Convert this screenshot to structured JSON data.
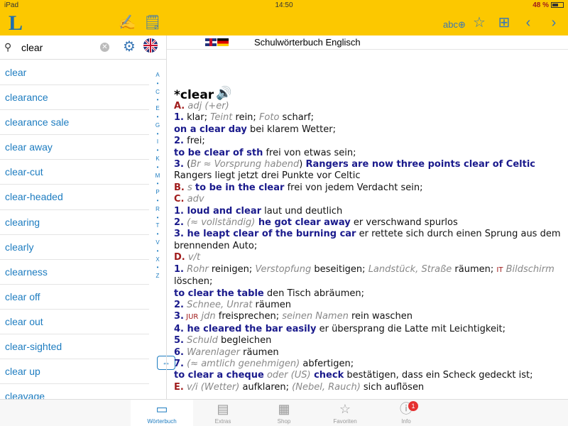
{
  "status": {
    "device": "iPad",
    "time": "14:50",
    "battery": "48 %",
    "battery_level": 0.48
  },
  "toolbar": {
    "logo": "L",
    "icons": [
      "handwriting-icon",
      "vocabulary-card-icon",
      "add-word-icon",
      "star-add-icon",
      "folder-add-icon",
      "back-arrow-icon",
      "forward-arrow-icon"
    ],
    "accent": "#fcc800",
    "icon_color": "#3a78b6"
  },
  "search": {
    "value": "clear",
    "placeholder": ""
  },
  "wordlist": {
    "items": [
      "clear",
      "clearance",
      "clearance sale",
      "clear away",
      "clear-cut",
      "clear-headed",
      "clearing",
      "clearly",
      "clearness",
      "clear off",
      "clear out",
      "clear-sighted",
      "clear up",
      "cleavage"
    ],
    "link_color": "#1d7cc0"
  },
  "alphabet": [
    "A",
    "•",
    "C",
    "•",
    "E",
    "•",
    "G",
    "•",
    "I",
    "•",
    "K",
    "•",
    "M",
    "•",
    "P",
    "•",
    "R",
    "•",
    "T",
    "•",
    "V",
    "•",
    "X",
    "•",
    "Z"
  ],
  "dictionary": {
    "title": "Schulwörterbuch Englisch"
  },
  "entry": {
    "headword": "*clear",
    "lines": [
      [
        {
          "c": "r",
          "t": "A."
        },
        {
          "c": "it",
          "t": " adj (+er)"
        }
      ],
      [
        {
          "c": "b",
          "t": "1."
        },
        {
          "c": "",
          "t": " klar; "
        },
        {
          "c": "it",
          "t": "Teint"
        },
        {
          "c": "",
          "t": " rein; "
        },
        {
          "c": "it",
          "t": "Foto"
        },
        {
          "c": "",
          "t": " scharf;"
        }
      ],
      [
        {
          "c": "ex",
          "t": "on a clear day"
        },
        {
          "c": "",
          "t": " bei klarem Wetter;"
        }
      ],
      [
        {
          "c": "b",
          "t": "2."
        },
        {
          "c": "",
          "t": " frei;"
        }
      ],
      [
        {
          "c": "ex",
          "t": "to be clear of sth"
        },
        {
          "c": "",
          "t": " frei von etwas sein;"
        }
      ],
      [
        {
          "c": "b",
          "t": "3."
        },
        {
          "c": "",
          "t": " ("
        },
        {
          "c": "it",
          "t": "Br ≈ Vorsprung habend"
        },
        {
          "c": "",
          "t": ") "
        },
        {
          "c": "ex",
          "t": "Rangers are now three points clear of Celtic"
        },
        {
          "c": "",
          "t": " Rangers liegt jetzt drei Punkte vor Celtic"
        }
      ],
      [
        {
          "c": "r",
          "t": "B."
        },
        {
          "c": "it",
          "t": " s "
        },
        {
          "c": "ex",
          "t": "to be in the clear"
        },
        {
          "c": "",
          "t": " frei von jedem Verdacht sein;"
        }
      ],
      [
        {
          "c": "r",
          "t": "C."
        },
        {
          "c": "it",
          "t": " adv"
        }
      ],
      [
        {
          "c": "b",
          "t": "1."
        },
        {
          "c": "ex",
          "t": " loud and clear"
        },
        {
          "c": "",
          "t": " laut und deutlich"
        }
      ],
      [
        {
          "c": "b",
          "t": "2."
        },
        {
          "c": "it",
          "t": " (≈ vollständig)"
        },
        {
          "c": "ex",
          "t": " he got clear away"
        },
        {
          "c": "",
          "t": " er verschwand spurlos"
        }
      ],
      [
        {
          "c": "b",
          "t": "3."
        },
        {
          "c": "ex",
          "t": " he leapt clear of the burning car"
        },
        {
          "c": "",
          "t": " er rettete sich durch einen Sprung aus dem brennenden Auto;"
        }
      ],
      [
        {
          "c": "r",
          "t": "D."
        },
        {
          "c": "it",
          "t": " v/t"
        }
      ],
      [
        {
          "c": "b",
          "t": "1."
        },
        {
          "c": "it",
          "t": " Rohr"
        },
        {
          "c": "",
          "t": " reinigen; "
        },
        {
          "c": "it",
          "t": "Verstopfung"
        },
        {
          "c": "",
          "t": " beseitigen; "
        },
        {
          "c": "it",
          "t": "Landstück, Straße"
        },
        {
          "c": "",
          "t": " räumen; "
        },
        {
          "c": "lab",
          "t": "IT"
        },
        {
          "c": "it",
          "t": " Bildschirm"
        },
        {
          "c": "",
          "t": " löschen;"
        }
      ],
      [
        {
          "c": "ex",
          "t": "to clear the table"
        },
        {
          "c": "",
          "t": " den Tisch abräumen;"
        }
      ],
      [
        {
          "c": "b",
          "t": "2."
        },
        {
          "c": "it",
          "t": " Schnee, Unrat"
        },
        {
          "c": "",
          "t": " räumen"
        }
      ],
      [
        {
          "c": "b",
          "t": "3."
        },
        {
          "c": "lab",
          "t": " JUR"
        },
        {
          "c": "it",
          "t": " jdn"
        },
        {
          "c": "",
          "t": " freisprechen; "
        },
        {
          "c": "it",
          "t": "seinen Namen"
        },
        {
          "c": "",
          "t": " rein waschen"
        }
      ],
      [
        {
          "c": "b",
          "t": "4."
        },
        {
          "c": "ex",
          "t": " he cleared the bar easily"
        },
        {
          "c": "",
          "t": " er übersprang die Latte mit Leichtigkeit;"
        }
      ],
      [
        {
          "c": "b",
          "t": "5."
        },
        {
          "c": "it",
          "t": " Schuld"
        },
        {
          "c": "",
          "t": " begleichen"
        }
      ],
      [
        {
          "c": "b",
          "t": "6."
        },
        {
          "c": "it",
          "t": " Warenlager"
        },
        {
          "c": "",
          "t": " räumen"
        }
      ],
      [
        {
          "c": "b",
          "t": "7."
        },
        {
          "c": "it",
          "t": " (≈ amtlich genehmigen)"
        },
        {
          "c": "",
          "t": " abfertigen;"
        }
      ],
      [
        {
          "c": "ex",
          "t": "to clear a cheque"
        },
        {
          "c": "it",
          "t": " oder (US)"
        },
        {
          "c": "ex",
          "t": " check"
        },
        {
          "c": "",
          "t": " bestätigen, dass ein Scheck gedeckt ist;"
        }
      ],
      [
        {
          "c": "r",
          "t": "E."
        },
        {
          "c": "it",
          "t": " v/i (Wetter)"
        },
        {
          "c": "",
          "t": " aufklaren; "
        },
        {
          "c": "it",
          "t": "(Nebel, Rauch)"
        },
        {
          "c": "",
          "t": " sich auflösen"
        }
      ]
    ]
  },
  "tabs": [
    {
      "label": "Wörterbuch",
      "icon": "book-icon",
      "active": true
    },
    {
      "label": "Extras",
      "icon": "box-icon",
      "active": false
    },
    {
      "label": "Shop",
      "icon": "cabinet-icon",
      "active": false
    },
    {
      "label": "Favoriten",
      "icon": "star-icon",
      "active": false
    },
    {
      "label": "Info",
      "icon": "info-icon",
      "active": false,
      "badge": "1"
    }
  ]
}
